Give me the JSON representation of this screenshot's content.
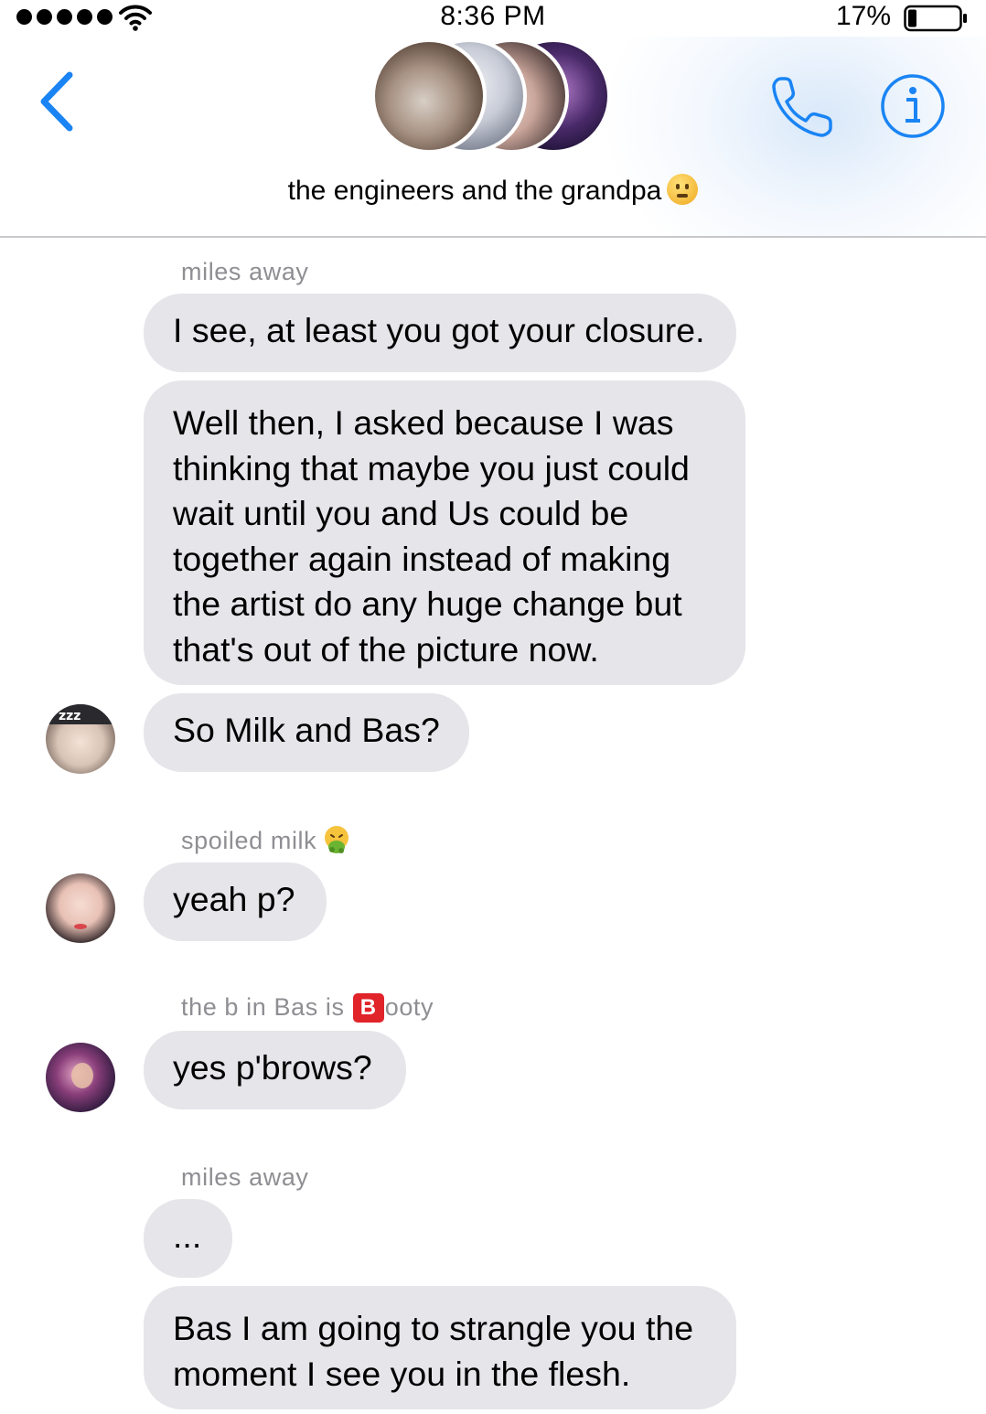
{
  "status_bar": {
    "time": "8:36 PM",
    "battery_percent": "17%",
    "signal_bars": 5,
    "battery_level": 0.17
  },
  "header": {
    "back_icon": "chevron-left-icon",
    "call_icon": "phone-icon",
    "info_icon": "info-icon",
    "group_title": "the engineers and the grandpa",
    "title_emoji": "sad-face-emoji",
    "accent_color": "#1a84f4"
  },
  "messages": {
    "sender_1": "miles away",
    "msg_1": "I see, at least you got your closure.",
    "msg_2": "Well then, I asked because I was\nthinking that maybe you just could\nwait until you and Us could be\ntogether again instead of making\nthe artist do any huge change but\nthat's out of the picture now.",
    "msg_3": "So Milk and Bas?",
    "sender_2": "spoiled milk",
    "sender_2_emoji": "vomiting-face-emoji",
    "msg_4": "yeah p?",
    "sender_3_pre": "the b in Bas is ",
    "sender_3_badge": "B",
    "sender_3_post": "ooty",
    "msg_5": "yes p'brows?",
    "sender_4": "miles away",
    "msg_6": "...",
    "msg_7": "Bas I am going to strangle you the\nmoment I see you in the flesh."
  },
  "colors": {
    "bubble": "#e5e5ea",
    "sender_text": "#8e8e93",
    "divider": "#c8c8cc"
  }
}
